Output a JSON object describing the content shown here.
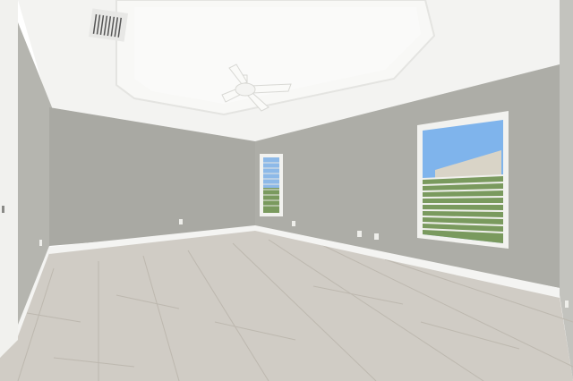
{
  "scene": {
    "kind": "empty-room-photo",
    "colors": {
      "ceiling": "#f2f2f0",
      "tray": "#f7f7f5",
      "wall_left": "#b7b7b1",
      "wall_back": "#a9a9a3",
      "wall_right": "#b0b0aa",
      "baseboard": "#f5f5f3",
      "floor": "#cfcbc4",
      "floor_seam": "#b9b4ab",
      "window_sky": "#7fb4ec",
      "window_blind": "#f1f1ee",
      "window_foliage": "#7a9a5e"
    },
    "icons": [
      "ceiling-fan-icon",
      "air-vent-icon"
    ]
  }
}
